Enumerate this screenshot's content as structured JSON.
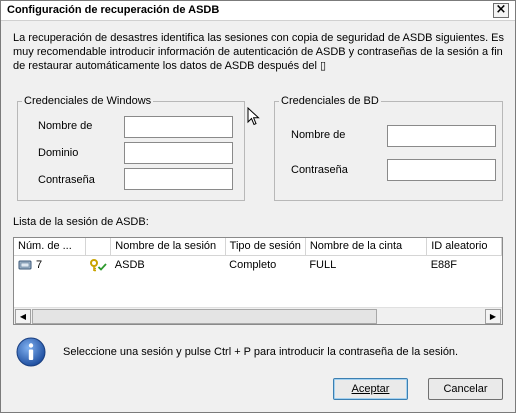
{
  "window": {
    "title": "Configuración de recuperación de ASDB",
    "close_glyph": "×"
  },
  "intro_text": "La recuperación de desastres identifica las sesiones con copia de seguridad de ASDB siguientes. Es muy recomendable introducir información de autenticación de ASDB y contraseñas de la sesión a fin de restaurar automáticamente los datos de ASDB después del ▯",
  "windows_credentials": {
    "legend": "Credenciales de Windows",
    "username_label": "Nombre de",
    "username_value": "",
    "domain_label": "Dominio",
    "domain_value": "",
    "password_label": "Contraseña",
    "password_value": ""
  },
  "db_credentials": {
    "legend": "Credenciales de BD",
    "username_label": "Nombre de",
    "username_value": "",
    "password_label": "Contraseña",
    "password_value": ""
  },
  "session_list": {
    "label": "Lista de la sesión de ASDB:",
    "columns": [
      "Núm. de ...",
      "",
      "Nombre de la sesión",
      "Tipo de sesión",
      "Nombre de la cinta",
      "ID aleatorio"
    ],
    "rows": [
      {
        "number": "7",
        "icon": "key-check-icon",
        "session_name": "ASDB",
        "session_type": "Completo",
        "tape_name": "FULL",
        "random_id": "E88F"
      }
    ]
  },
  "info": {
    "icon": "info-icon",
    "text": "Seleccione una sesión y pulse Ctrl + P para introducir la contraseña de la sesión."
  },
  "buttons": {
    "accept": "Aceptar",
    "cancel": "Cancelar"
  },
  "colors": {
    "info_blue": "#2a5db0",
    "key_yellow": "#e0c000",
    "check_green": "#2e9a2e"
  }
}
